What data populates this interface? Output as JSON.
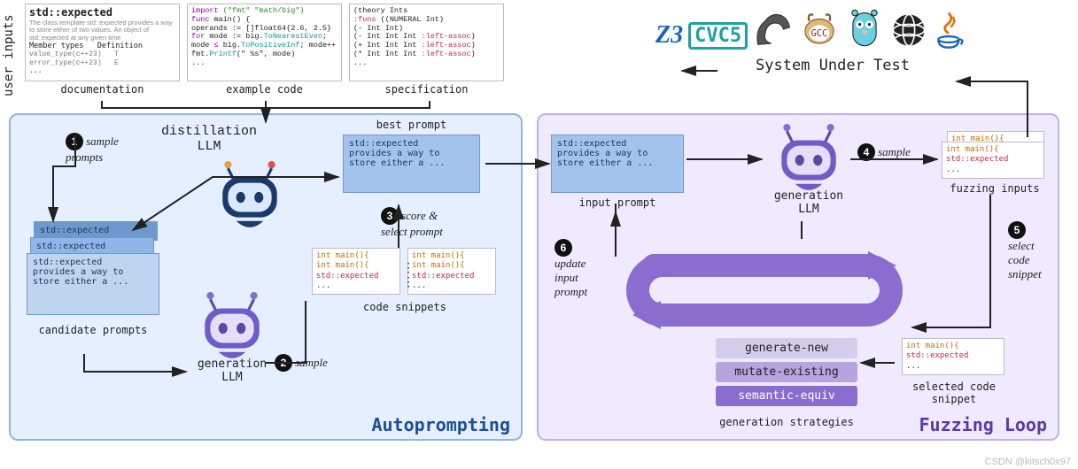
{
  "vertical_label": "user inputs",
  "inputs": {
    "doc": {
      "title": "std::expected",
      "desc": "The class template std::expected provides a way to store either of two values. An object of std::expected at any given time",
      "col1": "Member types",
      "col2": "Definition",
      "row1a": "value_type(c++23)",
      "row1b": "T",
      "row2a": "error_type(c++23)",
      "row2b": "E",
      "ellipsis": "...",
      "caption": "documentation"
    },
    "code": {
      "l1a": "import",
      "l1b": "(\"fmt\" \"math/big\")",
      "l2a": "func",
      "l2b": " main() {",
      "l3": "  operands := []float64{2.6, 2.5}",
      "l4a": "  for",
      "l4b": " mode := big.",
      "l4c": "ToNearestEven",
      "l4d": ";",
      "l5a": "  mode ",
      "l5b": "≤",
      "l5c": " big.",
      "l5d": "ToPositiveInf",
      "l5e": "; mode++",
      "l6a": "      fmt.",
      "l6b": "Printf",
      "l6c": "(\"  %s\", mode)",
      "l7": "  ...",
      "caption": "example code"
    },
    "spec": {
      "l1": "(theory Ints",
      "l2a": ":funs",
      "l2b": " ((NUMERAL Int)",
      "l3": "      (- Int Int)",
      "l4a": "      (- Int Int Int ",
      "l4b": ":left-assoc",
      "l4c": ")",
      "l5a": "      (+ Int Int Int ",
      "l5b": ":left-assoc",
      "l5c": ")",
      "l6a": "      (* Int Int Int ",
      "l6b": ":left-assoc",
      "l6c": ")",
      "l7": " ...",
      "caption": "specification"
    }
  },
  "left": {
    "title": "Autoprompting",
    "distill_label": "distillation\nLLM",
    "gen_label": "generation\nLLM",
    "step1": "sample\nprompts",
    "step2": "sample",
    "step3": "score &\nselect prompt",
    "cand_small": "std::expected",
    "cand_big": "std::expected\nprovides a way to\nstore either a ...",
    "cand_caption": "candidate prompts",
    "best_prompt": "std::expected\nprovides a way to\nstore either a ...",
    "best_caption": "best prompt",
    "code_l1": "int main(){",
    "code_l2": "int main(){",
    "code_l3": "std::expected",
    "code_l4": "...",
    "snip_caption": "code snippets"
  },
  "right": {
    "title": "Fuzzing Loop",
    "input_prompt": "std::expected\nprovides a way to\nstore either a ...",
    "input_caption": "input prompt",
    "gen_label": "generation\nLLM",
    "step4": "sample",
    "step5": "select\ncode\nsnippet",
    "step6": "update\ninput\nprompt",
    "fuzz_l1": "int main(){",
    "fuzz_l2": "int main(){",
    "fuzz_l3": "std::expected",
    "fuzz_l4": "...",
    "fuzz_caption": "fuzzing inputs",
    "sel_l1": "int main(){",
    "sel_l2": "std::expected",
    "sel_l3": "...",
    "sel_caption": "selected code\nsnippet",
    "strat1": "generate-new",
    "strat2": "mutate-existing",
    "strat3": "semantic-equiv",
    "strat_caption": "generation strategies"
  },
  "sut": {
    "label": "System Under Test",
    "z3": "Z3",
    "cvc5": "CVC5",
    "gcc": "GCC"
  },
  "watermark": "CSDN @kitsch0x97"
}
